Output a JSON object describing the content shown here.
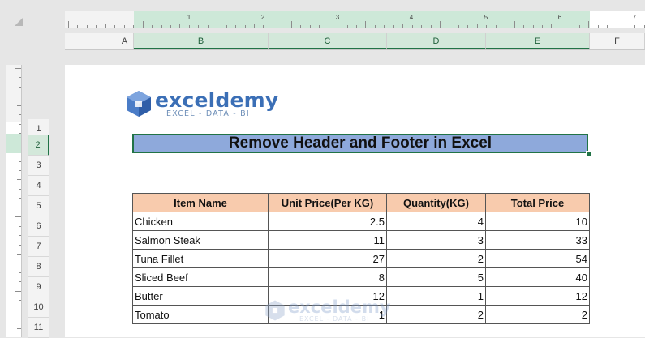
{
  "ruler": {
    "numbers": [
      "1",
      "2",
      "3",
      "4",
      "5",
      "6",
      "7"
    ]
  },
  "columns": [
    "A",
    "B",
    "C",
    "D",
    "E",
    "F"
  ],
  "rows": [
    "1",
    "2",
    "3",
    "4",
    "5",
    "6",
    "7",
    "8",
    "9",
    "10",
    "11"
  ],
  "logo": {
    "name": "exceldemy",
    "tagline": "EXCEL - DATA - BI"
  },
  "title": "Remove Header and Footer in Excel",
  "table": {
    "headers": [
      "Item Name",
      "Unit Price(Per KG)",
      "Quantity(KG)",
      "Total Price"
    ],
    "rows": [
      [
        "Chicken",
        "2.5",
        "4",
        "10"
      ],
      [
        "Salmon Steak",
        "11",
        "3",
        "33"
      ],
      [
        "Tuna Fillet",
        "27",
        "2",
        "54"
      ],
      [
        "Sliced Beef",
        "8",
        "5",
        "40"
      ],
      [
        "Butter",
        "12",
        "1",
        "12"
      ],
      [
        "Tomato",
        "1",
        "2",
        "2"
      ]
    ]
  },
  "watermark": {
    "name": "exceldemy",
    "tagline": "EXCEL - DATA - BI"
  },
  "colors": {
    "accent": "#217346",
    "title_fill": "#8ea9db",
    "header_fill": "#f8cbad",
    "logo_blue": "#3b6fb6"
  }
}
